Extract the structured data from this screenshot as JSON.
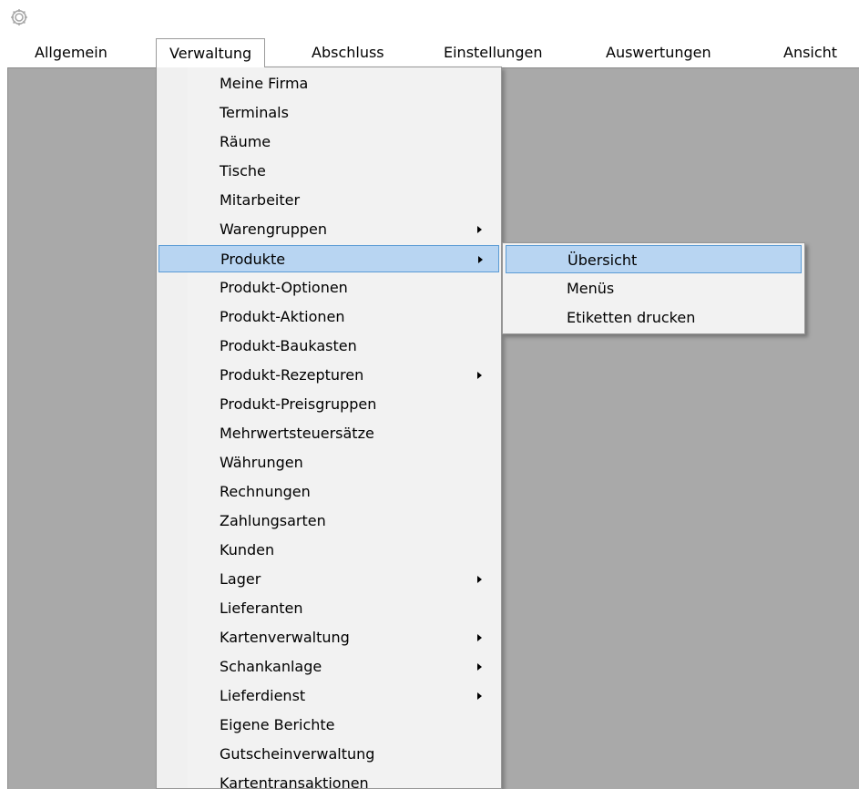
{
  "app": {
    "icon": "gear-icon"
  },
  "menubar": {
    "items": [
      {
        "label": "Allgemein"
      },
      {
        "label": "Verwaltung"
      },
      {
        "label": "Abschluss"
      },
      {
        "label": "Einstellungen"
      },
      {
        "label": "Auswertungen"
      },
      {
        "label": "Ansicht"
      }
    ],
    "open_item": "Verwaltung"
  },
  "dropdown": {
    "items": [
      {
        "label": "Meine Firma",
        "submenu": false
      },
      {
        "label": "Terminals",
        "submenu": false
      },
      {
        "label": "Räume",
        "submenu": false
      },
      {
        "label": "Tische",
        "submenu": false
      },
      {
        "label": "Mitarbeiter",
        "submenu": false
      },
      {
        "label": "Warengruppen",
        "submenu": true
      },
      {
        "label": "Produkte",
        "submenu": true
      },
      {
        "label": "Produkt-Optionen",
        "submenu": false
      },
      {
        "label": "Produkt-Aktionen",
        "submenu": false
      },
      {
        "label": "Produkt-Baukasten",
        "submenu": false
      },
      {
        "label": "Produkt-Rezepturen",
        "submenu": true
      },
      {
        "label": "Produkt-Preisgruppen",
        "submenu": false
      },
      {
        "label": "Mehrwertsteuersätze",
        "submenu": false
      },
      {
        "label": "Währungen",
        "submenu": false
      },
      {
        "label": "Rechnungen",
        "submenu": false
      },
      {
        "label": "Zahlungsarten",
        "submenu": false
      },
      {
        "label": "Kunden",
        "submenu": false
      },
      {
        "label": "Lager",
        "submenu": true
      },
      {
        "label": "Lieferanten",
        "submenu": false
      },
      {
        "label": "Kartenverwaltung",
        "submenu": true
      },
      {
        "label": "Schankanlage",
        "submenu": true
      },
      {
        "label": "Lieferdienst",
        "submenu": true
      },
      {
        "label": "Eigene Berichte",
        "submenu": false
      },
      {
        "label": "Gutscheinverwaltung",
        "submenu": false
      },
      {
        "label": "Kartentransaktionen",
        "submenu": false
      }
    ],
    "highlighted": "Produkte"
  },
  "submenu": {
    "items": [
      {
        "label": "Übersicht"
      },
      {
        "label": "Menüs"
      },
      {
        "label": "Etiketten drucken"
      }
    ],
    "highlighted": "Übersicht"
  },
  "colors": {
    "workspace": "#a9a9a9",
    "highlight_fill": "#b8d5f2",
    "highlight_border": "#5b9bd5",
    "menu_background": "#f2f2f2"
  }
}
